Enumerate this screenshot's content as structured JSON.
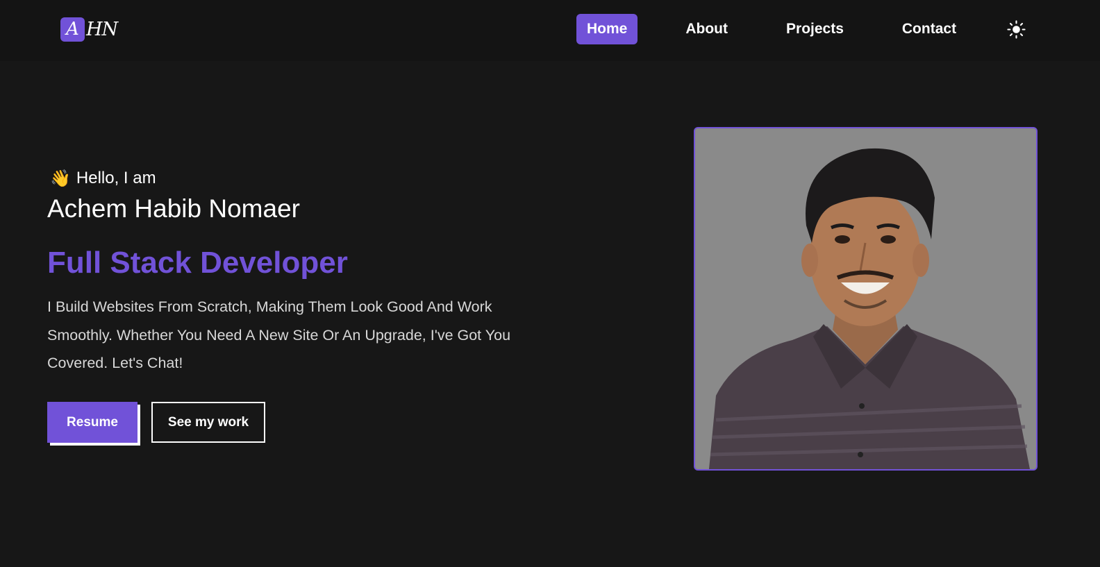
{
  "logo": {
    "initial": "A",
    "rest": "HN"
  },
  "nav": {
    "items": [
      {
        "label": "Home",
        "active": true
      },
      {
        "label": "About",
        "active": false
      },
      {
        "label": "Projects",
        "active": false
      },
      {
        "label": "Contact",
        "active": false
      }
    ],
    "theme_toggle_icon": "sun-icon"
  },
  "hero": {
    "wave_emoji": "👋",
    "greeting": "Hello, I am",
    "name": "Achem Habib Nomaer",
    "role": "Full Stack Developer",
    "description": "I Build Websites From Scratch, Making Them Look Good And Work Smoothly. Whether You Need A New Site Or An Upgrade, I've Got You Covered. Let's Chat!",
    "resume_label": "Resume",
    "work_label": "See my work"
  },
  "colors": {
    "accent": "#7152d8",
    "background": "#171717",
    "navbar": "#141414",
    "photo_bg": "#8a8a8a"
  }
}
